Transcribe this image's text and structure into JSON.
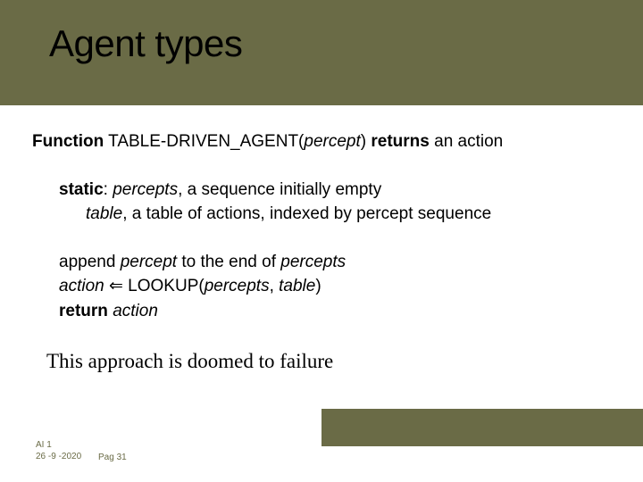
{
  "title": "Agent types",
  "fn": {
    "kw_function": "Function",
    "name": "TABLE-DRIVEN_AGENT(",
    "param": "percept",
    "close": ")",
    "kw_returns": "returns",
    "returns_tail": " an action"
  },
  "static": {
    "kw_static": "static",
    "colon": ": ",
    "percepts": "percepts",
    "percepts_tail": ", a sequence initially empty",
    "table": "table",
    "table_tail": ", a table of actions, indexed by percept sequence"
  },
  "body": {
    "append_pre": "append ",
    "percept": "percept",
    "append_mid": " to the end of ",
    "percepts": "percepts",
    "action": "action",
    "arrow": " ⇐ LOOKUP(",
    "lookup_p1": "percepts",
    "comma": ", ",
    "lookup_p2": "table",
    "close": ")",
    "kw_return": "return",
    "return_sp": " ",
    "return_val": "action"
  },
  "conclusion": "This approach is doomed to failure",
  "footer": {
    "course": "AI 1",
    "date": "26 -9 -2020",
    "page": "Pag 31"
  }
}
